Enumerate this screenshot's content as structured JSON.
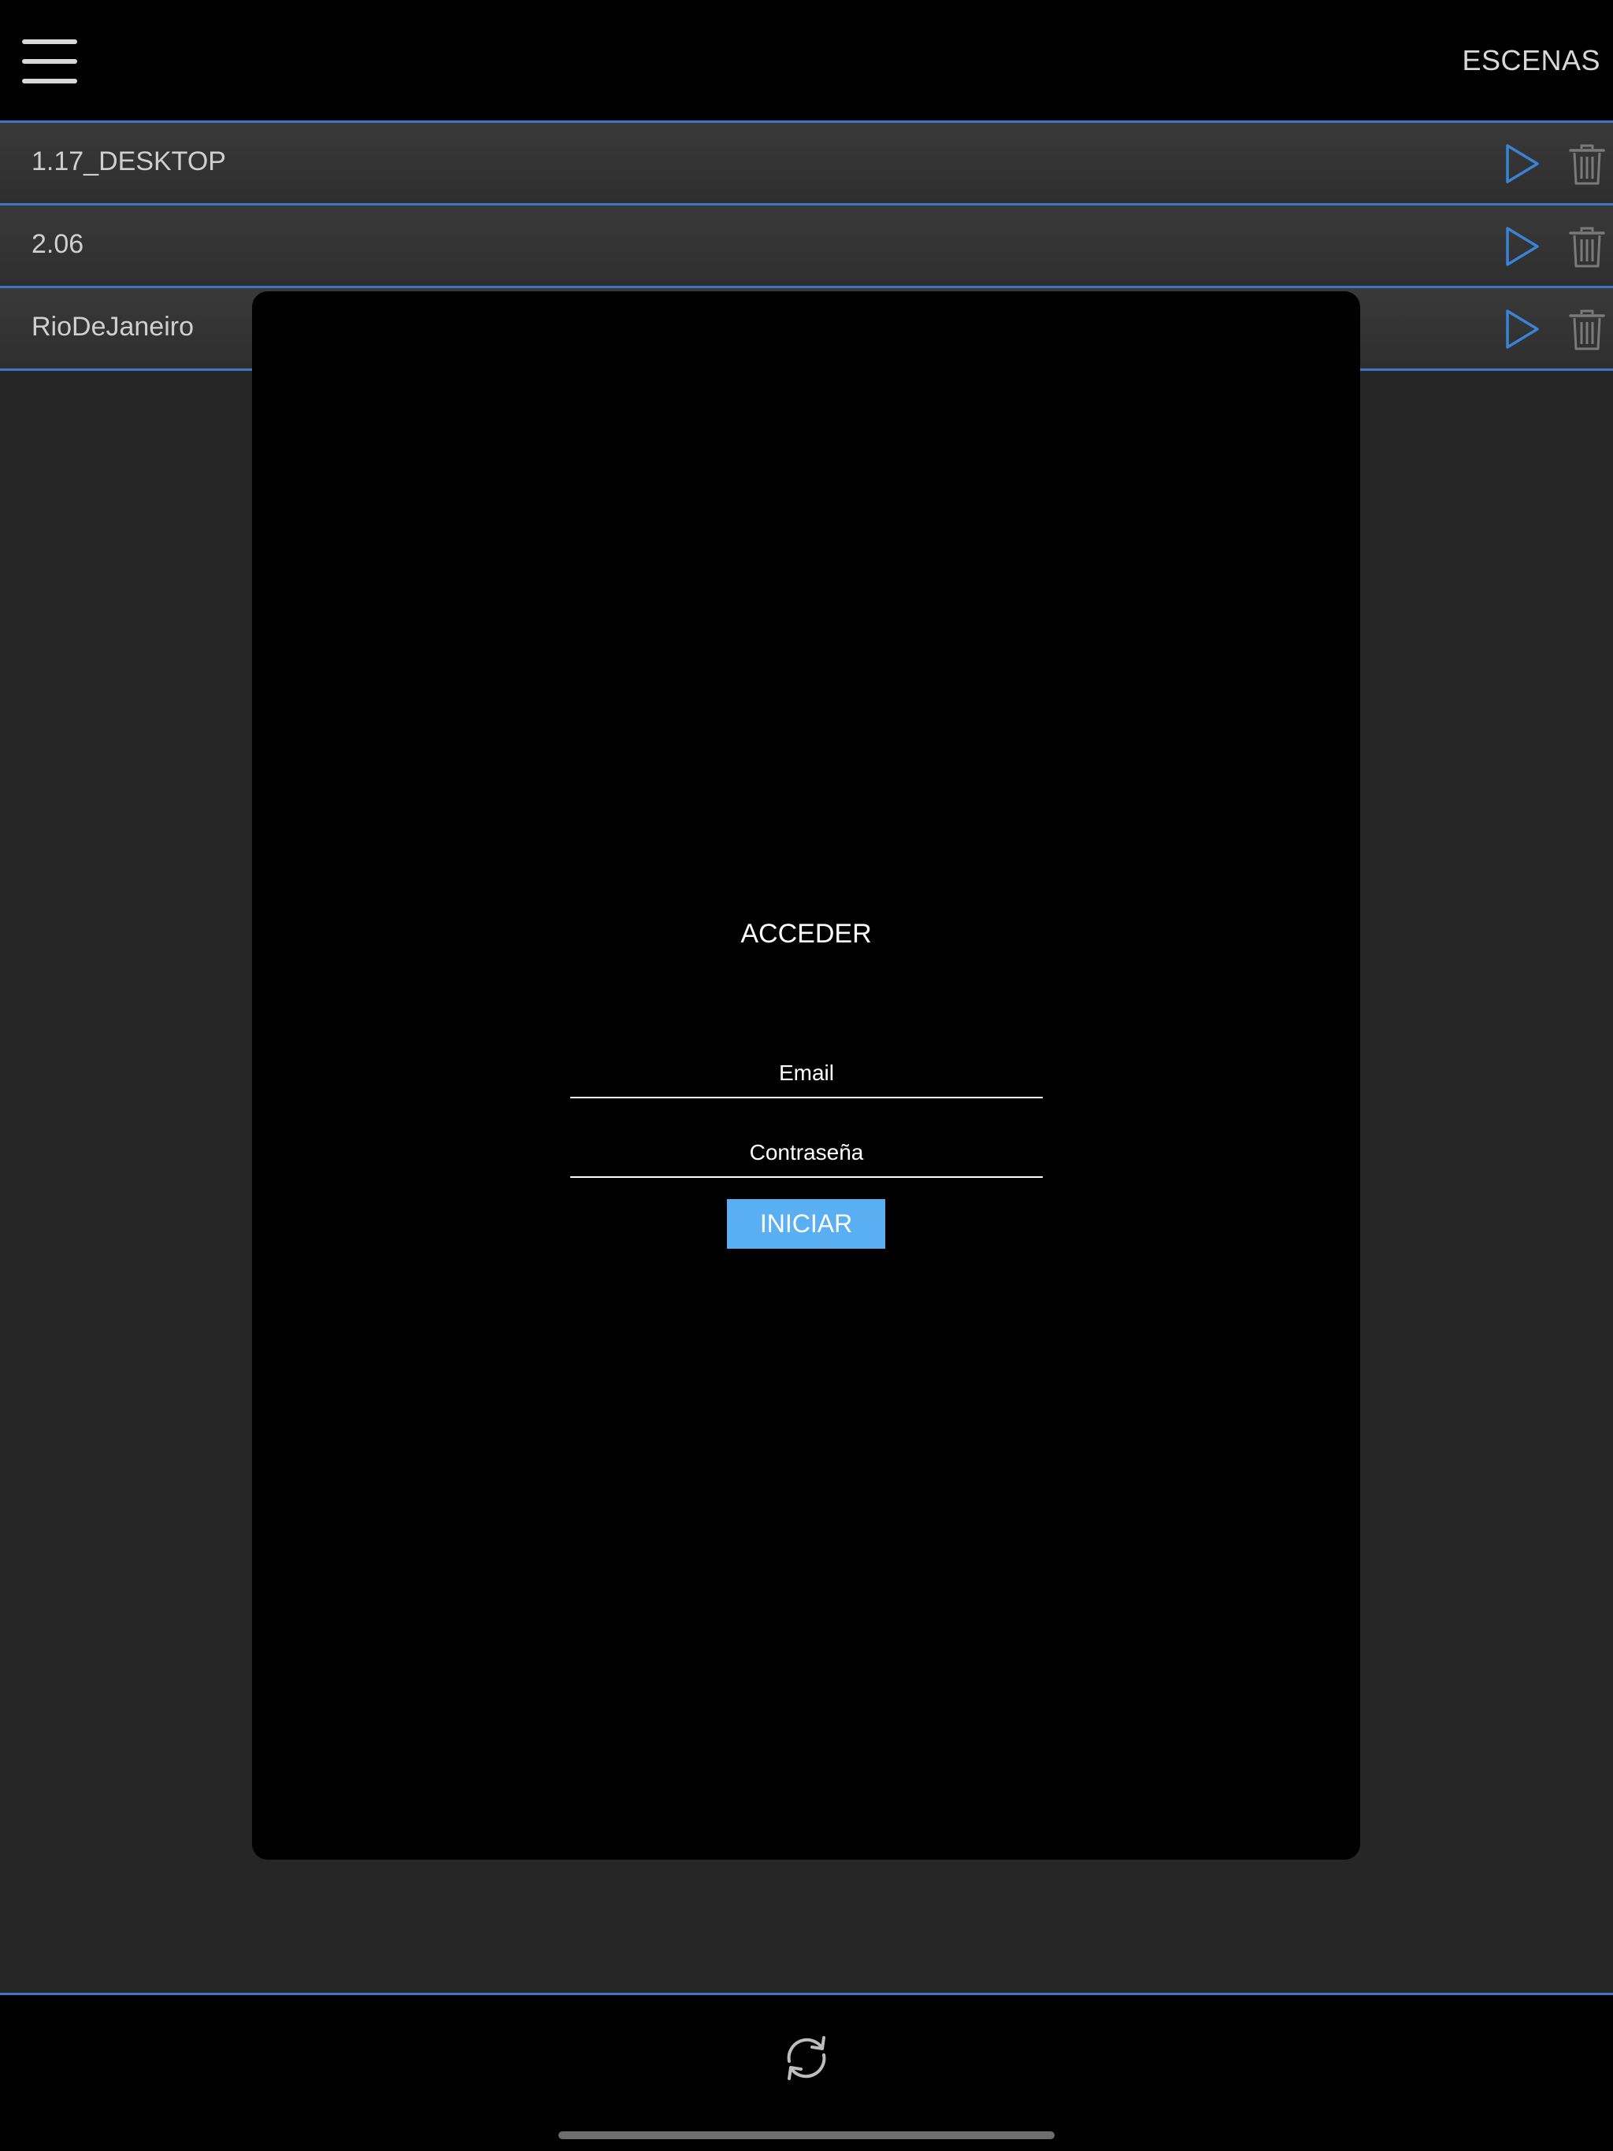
{
  "header": {
    "title": "ESCENAS",
    "menu_icon": "hamburger-menu-icon"
  },
  "scenes": [
    {
      "name": "1.17_DESKTOP"
    },
    {
      "name": "2.06"
    },
    {
      "name": "RioDeJaneiro"
    }
  ],
  "scene_actions": {
    "play_icon": "play-icon",
    "delete_icon": "trash-icon"
  },
  "login": {
    "title": "ACCEDER",
    "email_placeholder": "Email",
    "password_placeholder": "Contraseña",
    "submit_label": "INICIAR"
  },
  "footer": {
    "refresh_icon": "refresh-icon"
  },
  "colors": {
    "accent": "#3a78c4",
    "button": "#5aaef2",
    "background": "#262626",
    "bars": "#000000"
  }
}
